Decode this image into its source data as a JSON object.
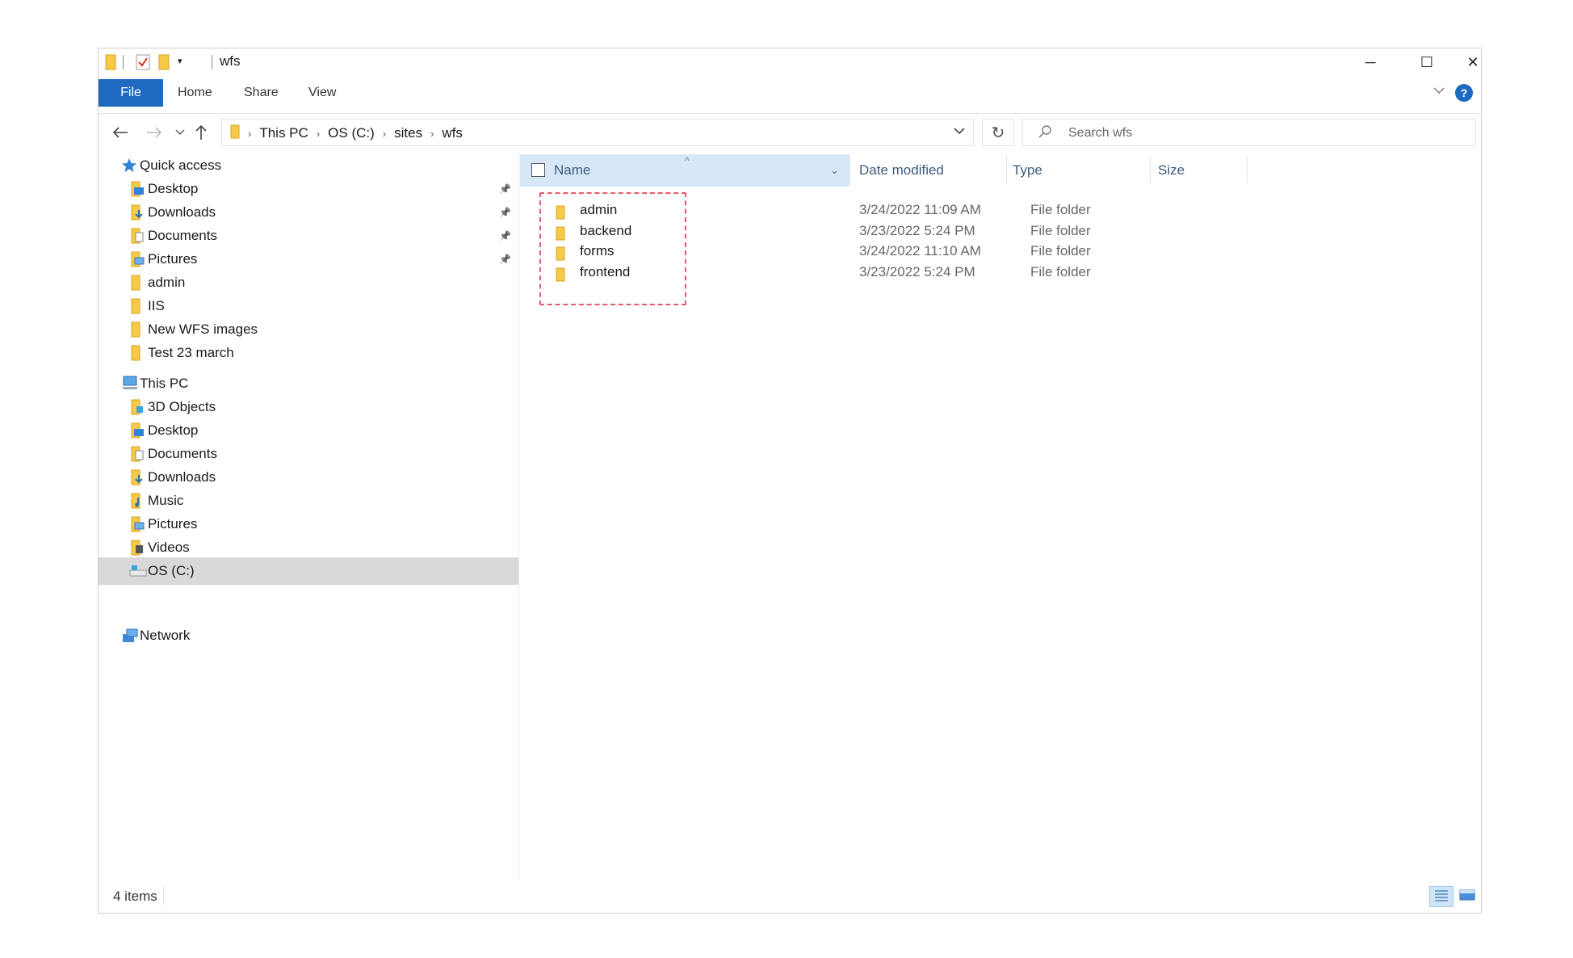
{
  "window": {
    "title": "wfs",
    "controls": {
      "minimize": "─",
      "maximize": "☐",
      "close": "✕"
    }
  },
  "ribbon": {
    "tabs": [
      "File",
      "Home",
      "Share",
      "View"
    ],
    "help": "?"
  },
  "address": {
    "breadcrumbs": [
      "This PC",
      "OS (C:)",
      "sites",
      "wfs"
    ]
  },
  "search": {
    "placeholder": "Search wfs"
  },
  "nav": {
    "quick_access": {
      "label": "Quick access",
      "items": [
        {
          "label": "Desktop",
          "icon": "desktop-folder-icon",
          "pinned": true
        },
        {
          "label": "Downloads",
          "icon": "downloads-folder-icon",
          "pinned": true
        },
        {
          "label": "Documents",
          "icon": "documents-folder-icon",
          "pinned": true
        },
        {
          "label": "Pictures",
          "icon": "pictures-folder-icon",
          "pinned": true
        },
        {
          "label": "admin",
          "icon": "folder-icon",
          "pinned": false
        },
        {
          "label": "IIS",
          "icon": "folder-icon",
          "pinned": false
        },
        {
          "label": "New WFS images",
          "icon": "folder-icon",
          "pinned": false
        },
        {
          "label": "Test 23 march",
          "icon": "folder-icon",
          "pinned": false
        }
      ]
    },
    "this_pc": {
      "label": "This PC",
      "items": [
        {
          "label": "3D Objects",
          "icon": "3d-objects-folder-icon"
        },
        {
          "label": "Desktop",
          "icon": "desktop-folder-icon"
        },
        {
          "label": "Documents",
          "icon": "documents-folder-icon"
        },
        {
          "label": "Downloads",
          "icon": "downloads-folder-icon"
        },
        {
          "label": "Music",
          "icon": "music-folder-icon"
        },
        {
          "label": "Pictures",
          "icon": "pictures-folder-icon"
        },
        {
          "label": "Videos",
          "icon": "videos-folder-icon"
        },
        {
          "label": "OS (C:)",
          "icon": "drive-icon",
          "selected": true
        }
      ]
    },
    "network": {
      "label": "Network"
    }
  },
  "list": {
    "columns": {
      "name": "Name",
      "date": "Date modified",
      "type": "Type",
      "size": "Size"
    },
    "rows": [
      {
        "name": "admin",
        "date": "3/24/2022 11:09 AM",
        "type": "File folder"
      },
      {
        "name": "backend",
        "date": "3/23/2022 5:24 PM",
        "type": "File folder"
      },
      {
        "name": "forms",
        "date": "3/24/2022 11:10 AM",
        "type": "File folder"
      },
      {
        "name": "frontend",
        "date": "3/23/2022 5:24 PM",
        "type": "File folder"
      }
    ]
  },
  "status": {
    "item_count": "4 items"
  },
  "colors": {
    "accent": "#1e6ac1",
    "folder_yellow": "#f7c948",
    "header_highlight": "#d6e8f8",
    "selected_nav": "#d9d9d9",
    "annotation_dash": "#e8586b"
  }
}
